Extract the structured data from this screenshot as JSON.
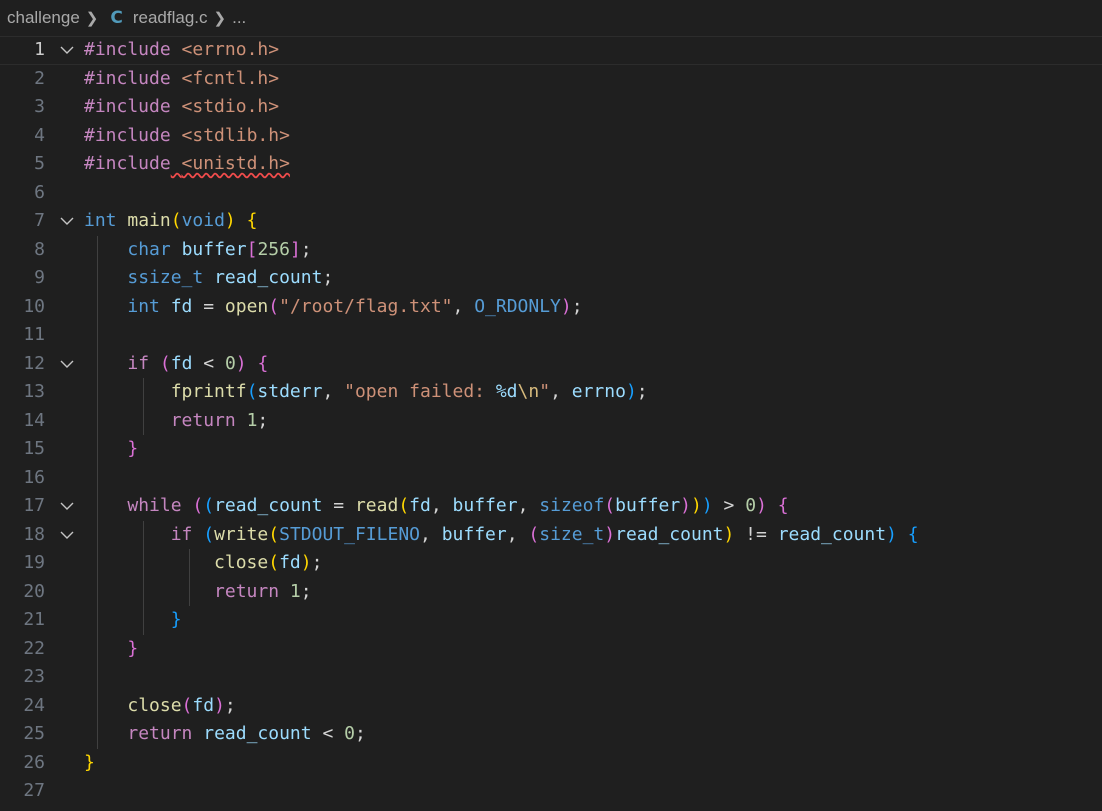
{
  "breadcrumb": {
    "folder": "challenge",
    "file_icon": "C",
    "file": "readflag.c",
    "more": "..."
  },
  "editor": {
    "current_line": 1,
    "folded_lines": [
      1,
      7,
      12,
      17,
      18
    ],
    "lines": [
      {
        "n": "1",
        "tokens": [
          [
            "t-kw",
            "#include"
          ],
          [
            "t-pun",
            " "
          ],
          [
            "t-str",
            "<errno.h>"
          ]
        ]
      },
      {
        "n": "2",
        "tokens": [
          [
            "t-kw",
            "#include"
          ],
          [
            "t-pun",
            " "
          ],
          [
            "t-str",
            "<fcntl.h>"
          ]
        ]
      },
      {
        "n": "3",
        "tokens": [
          [
            "t-kw",
            "#include"
          ],
          [
            "t-pun",
            " "
          ],
          [
            "t-str",
            "<stdio.h>"
          ]
        ]
      },
      {
        "n": "4",
        "tokens": [
          [
            "t-kw",
            "#include"
          ],
          [
            "t-pun",
            " "
          ],
          [
            "t-str",
            "<stdlib.h>"
          ]
        ]
      },
      {
        "n": "5",
        "squiggle": true,
        "tokens": [
          [
            "t-kw",
            "#include"
          ],
          [
            "t-pun",
            " "
          ],
          [
            "t-str",
            "<unistd.h>"
          ]
        ]
      },
      {
        "n": "6",
        "tokens": []
      },
      {
        "n": "7",
        "tokens": [
          [
            "t-type",
            "int"
          ],
          [
            "t-pun",
            " "
          ],
          [
            "t-fn",
            "main"
          ],
          [
            "t-b1",
            "("
          ],
          [
            "t-type",
            "void"
          ],
          [
            "t-b1",
            ")"
          ],
          [
            "t-pun",
            " "
          ],
          [
            "t-b1",
            "{"
          ]
        ]
      },
      {
        "n": "8",
        "tokens": [
          [
            "t-pun",
            "    "
          ],
          [
            "t-type",
            "char"
          ],
          [
            "t-pun",
            " "
          ],
          [
            "t-var",
            "buffer"
          ],
          [
            "t-b2",
            "["
          ],
          [
            "t-num",
            "256"
          ],
          [
            "t-b2",
            "]"
          ],
          [
            "t-pun",
            ";"
          ]
        ]
      },
      {
        "n": "9",
        "tokens": [
          [
            "t-pun",
            "    "
          ],
          [
            "t-type",
            "ssize_t"
          ],
          [
            "t-pun",
            " "
          ],
          [
            "t-var",
            "read_count"
          ],
          [
            "t-pun",
            ";"
          ]
        ]
      },
      {
        "n": "10",
        "tokens": [
          [
            "t-pun",
            "    "
          ],
          [
            "t-type",
            "int"
          ],
          [
            "t-pun",
            " "
          ],
          [
            "t-var",
            "fd"
          ],
          [
            "t-pun",
            " = "
          ],
          [
            "t-fn",
            "open"
          ],
          [
            "t-b2",
            "("
          ],
          [
            "t-str",
            "\"/root/flag.txt\""
          ],
          [
            "t-pun",
            ", "
          ],
          [
            "t-mac",
            "O_RDONLY"
          ],
          [
            "t-b2",
            ")"
          ],
          [
            "t-pun",
            ";"
          ]
        ]
      },
      {
        "n": "11",
        "tokens": []
      },
      {
        "n": "12",
        "tokens": [
          [
            "t-pun",
            "    "
          ],
          [
            "t-kw",
            "if"
          ],
          [
            "t-pun",
            " "
          ],
          [
            "t-b2",
            "("
          ],
          [
            "t-var",
            "fd"
          ],
          [
            "t-pun",
            " < "
          ],
          [
            "t-num",
            "0"
          ],
          [
            "t-b2",
            ")"
          ],
          [
            "t-pun",
            " "
          ],
          [
            "t-b2",
            "{"
          ]
        ]
      },
      {
        "n": "13",
        "tokens": [
          [
            "t-pun",
            "        "
          ],
          [
            "t-fn",
            "fprintf"
          ],
          [
            "t-b3",
            "("
          ],
          [
            "t-var",
            "stderr"
          ],
          [
            "t-pun",
            ", "
          ],
          [
            "t-str",
            "\"open failed: "
          ],
          [
            "t-var",
            "%d"
          ],
          [
            "t-esc",
            "\\n"
          ],
          [
            "t-str",
            "\""
          ],
          [
            "t-pun",
            ", "
          ],
          [
            "t-var",
            "errno"
          ],
          [
            "t-b3",
            ")"
          ],
          [
            "t-pun",
            ";"
          ]
        ]
      },
      {
        "n": "14",
        "tokens": [
          [
            "t-pun",
            "        "
          ],
          [
            "t-kw",
            "return"
          ],
          [
            "t-pun",
            " "
          ],
          [
            "t-num",
            "1"
          ],
          [
            "t-pun",
            ";"
          ]
        ]
      },
      {
        "n": "15",
        "tokens": [
          [
            "t-pun",
            "    "
          ],
          [
            "t-b2",
            "}"
          ]
        ]
      },
      {
        "n": "16",
        "tokens": []
      },
      {
        "n": "17",
        "tokens": [
          [
            "t-pun",
            "    "
          ],
          [
            "t-kw",
            "while"
          ],
          [
            "t-pun",
            " "
          ],
          [
            "t-b2",
            "("
          ],
          [
            "t-b3",
            "("
          ],
          [
            "t-var",
            "read_count"
          ],
          [
            "t-pun",
            " = "
          ],
          [
            "t-fn",
            "read"
          ],
          [
            "t-b1",
            "("
          ],
          [
            "t-var",
            "fd"
          ],
          [
            "t-pun",
            ", "
          ],
          [
            "t-var",
            "buffer"
          ],
          [
            "t-pun",
            ", "
          ],
          [
            "t-type",
            "sizeof"
          ],
          [
            "t-b2",
            "("
          ],
          [
            "t-var",
            "buffer"
          ],
          [
            "t-b2",
            ")"
          ],
          [
            "t-b1",
            ")"
          ],
          [
            "t-b3",
            ")"
          ],
          [
            "t-pun",
            " > "
          ],
          [
            "t-num",
            "0"
          ],
          [
            "t-b2",
            ")"
          ],
          [
            "t-pun",
            " "
          ],
          [
            "t-b2",
            "{"
          ]
        ]
      },
      {
        "n": "18",
        "tokens": [
          [
            "t-pun",
            "        "
          ],
          [
            "t-kw",
            "if"
          ],
          [
            "t-pun",
            " "
          ],
          [
            "t-b3",
            "("
          ],
          [
            "t-fn",
            "write"
          ],
          [
            "t-b1",
            "("
          ],
          [
            "t-mac",
            "STDOUT_FILENO"
          ],
          [
            "t-pun",
            ", "
          ],
          [
            "t-var",
            "buffer"
          ],
          [
            "t-pun",
            ", "
          ],
          [
            "t-b2",
            "("
          ],
          [
            "t-type",
            "size_t"
          ],
          [
            "t-b2",
            ")"
          ],
          [
            "t-var",
            "read_count"
          ],
          [
            "t-b1",
            ")"
          ],
          [
            "t-pun",
            " != "
          ],
          [
            "t-var",
            "read_count"
          ],
          [
            "t-b3",
            ")"
          ],
          [
            "t-pun",
            " "
          ],
          [
            "t-b3",
            "{"
          ]
        ]
      },
      {
        "n": "19",
        "tokens": [
          [
            "t-pun",
            "            "
          ],
          [
            "t-fn",
            "close"
          ],
          [
            "t-b1",
            "("
          ],
          [
            "t-var",
            "fd"
          ],
          [
            "t-b1",
            ")"
          ],
          [
            "t-pun",
            ";"
          ]
        ]
      },
      {
        "n": "20",
        "tokens": [
          [
            "t-pun",
            "            "
          ],
          [
            "t-kw",
            "return"
          ],
          [
            "t-pun",
            " "
          ],
          [
            "t-num",
            "1"
          ],
          [
            "t-pun",
            ";"
          ]
        ]
      },
      {
        "n": "21",
        "tokens": [
          [
            "t-pun",
            "        "
          ],
          [
            "t-b3",
            "}"
          ]
        ]
      },
      {
        "n": "22",
        "tokens": [
          [
            "t-pun",
            "    "
          ],
          [
            "t-b2",
            "}"
          ]
        ]
      },
      {
        "n": "23",
        "tokens": []
      },
      {
        "n": "24",
        "tokens": [
          [
            "t-pun",
            "    "
          ],
          [
            "t-fn",
            "close"
          ],
          [
            "t-b2",
            "("
          ],
          [
            "t-var",
            "fd"
          ],
          [
            "t-b2",
            ")"
          ],
          [
            "t-pun",
            ";"
          ]
        ]
      },
      {
        "n": "25",
        "tokens": [
          [
            "t-pun",
            "    "
          ],
          [
            "t-kw",
            "return"
          ],
          [
            "t-pun",
            " "
          ],
          [
            "t-var",
            "read_count"
          ],
          [
            "t-pun",
            " < "
          ],
          [
            "t-num",
            "0"
          ],
          [
            "t-pun",
            ";"
          ]
        ]
      },
      {
        "n": "26",
        "tokens": [
          [
            "t-b1",
            "}"
          ]
        ]
      },
      {
        "n": "27",
        "tokens": []
      }
    ]
  }
}
